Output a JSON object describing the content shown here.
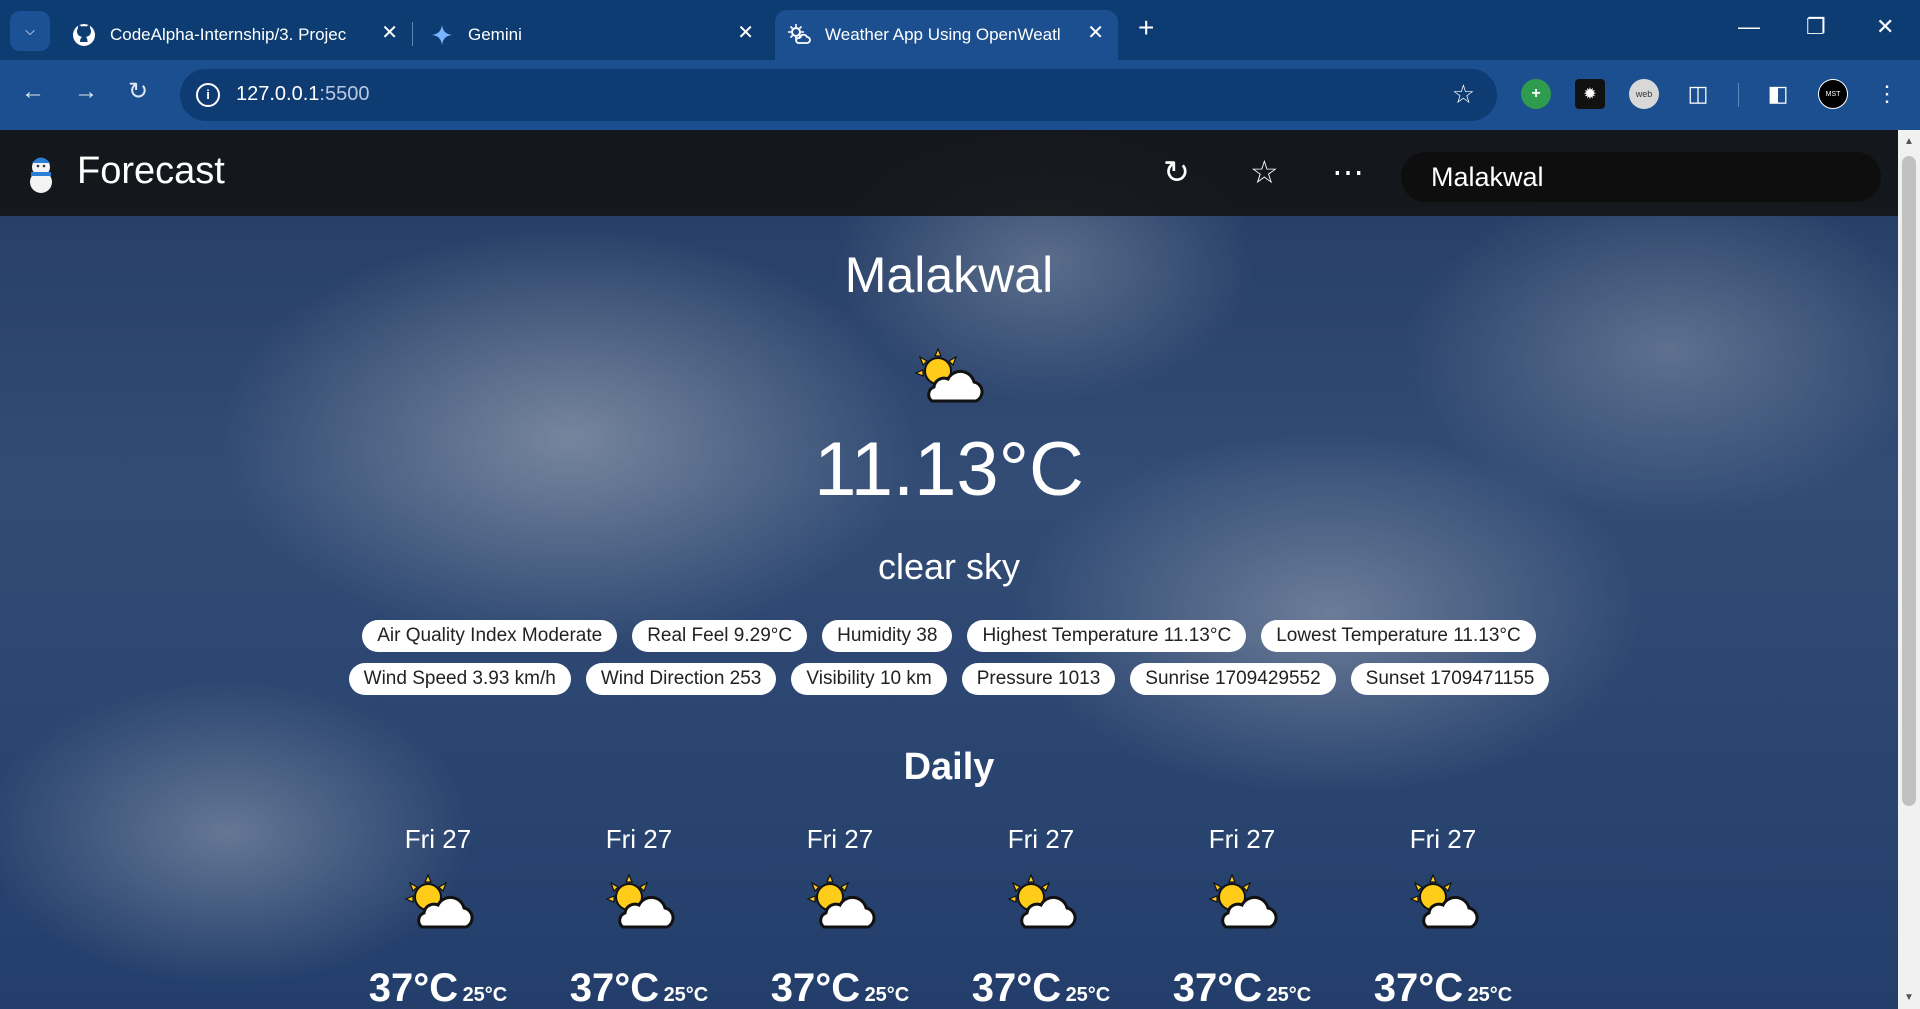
{
  "browser": {
    "tabs": [
      {
        "title": "CodeAlpha-Internship/3. Projec",
        "icon": "github-icon"
      },
      {
        "title": "Gemini",
        "icon": "gemini-sparkle-icon"
      },
      {
        "title": "Weather App Using OpenWeatl",
        "icon": "weather-icon",
        "active": true
      }
    ],
    "url_host": "127.0.0.1",
    "url_port": ":5500"
  },
  "app": {
    "brand": "Forecast",
    "search_value": "Malakwal"
  },
  "current": {
    "city": "Malakwal",
    "temperature": "11.13°C",
    "description": "clear sky",
    "details_row1": [
      "Air Quality Index Moderate",
      "Real Feel 9.29°C",
      "Humidity 38",
      "Highest Temperature 11.13°C",
      "Lowest Temperature 11.13°C"
    ],
    "details_row2": [
      "Wind Speed 3.93 km/h",
      "Wind Direction 253",
      "Visibility 10 km",
      "Pressure 1013",
      "Sunrise 1709429552",
      "Sunset 1709471155"
    ]
  },
  "daily": {
    "title": "Daily",
    "days": [
      {
        "name": "Fri 27",
        "high": "37°C",
        "low": "25°C"
      },
      {
        "name": "Fri 27",
        "high": "37°C",
        "low": "25°C"
      },
      {
        "name": "Fri 27",
        "high": "37°C",
        "low": "25°C"
      },
      {
        "name": "Fri 27",
        "high": "37°C",
        "low": "25°C"
      },
      {
        "name": "Fri 27",
        "high": "37°C",
        "low": "25°C"
      },
      {
        "name": "Fri 27",
        "high": "37°C",
        "low": "25°C"
      }
    ]
  }
}
